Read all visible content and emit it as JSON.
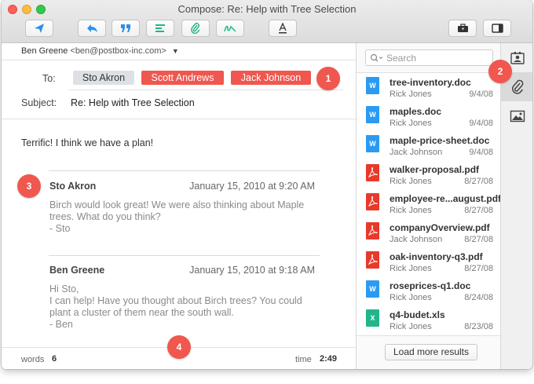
{
  "window": {
    "title": "Compose: Re: Help with Tree Selection"
  },
  "toolbar": {
    "buttons": [
      {
        "name": "send-icon",
        "color": "#2b8fe8"
      },
      {
        "name": "reply-icon",
        "color": "#2b8fe8"
      },
      {
        "name": "quote-icon",
        "color": "#2b8fe8"
      },
      {
        "name": "align-icon",
        "color": "#20b58a"
      },
      {
        "name": "attach-icon",
        "color": "#20b58a"
      },
      {
        "name": "signature-icon",
        "color": "#20b58a"
      },
      {
        "name": "text-format-icon",
        "color": "#333333"
      },
      {
        "name": "toolbox-icon",
        "color": "#333333"
      },
      {
        "name": "panel-toggle-icon",
        "color": "#333333"
      }
    ]
  },
  "from": {
    "name": "Ben Greene",
    "email": "<ben@postbox-inc.com>"
  },
  "to": {
    "label": "To:",
    "recipients": [
      {
        "name": "Sto Akron",
        "style": "grey"
      },
      {
        "name": "Scott Andrews",
        "style": "red"
      },
      {
        "name": "Jack Johnson",
        "style": "red"
      }
    ]
  },
  "subject": {
    "label": "Subject:",
    "value": "Re: Help with Tree Selection"
  },
  "body": {
    "intro": "Terrific! I think we have a plan!",
    "quotes": [
      {
        "author": "Sto Akron",
        "date": "January 15, 2010 at 9:20 AM",
        "lines": [
          "Birch would look great!  We were also thinking about Maple",
          "trees.  What do you think?",
          "- Sto"
        ]
      },
      {
        "author": "Ben Greene",
        "date": "January 15, 2010 at 9:18 AM",
        "lines": [
          "Hi Sto,",
          "I can help!  Have you thought about Birch trees?  You could",
          "plant a cluster of them near the south wall.",
          "- Ben"
        ]
      }
    ]
  },
  "status": {
    "words_label": "words",
    "words_value": "6",
    "time_label": "time",
    "time_value": "2:49"
  },
  "search": {
    "placeholder": "Search"
  },
  "attachments": [
    {
      "name": "tree-inventory.doc",
      "author": "Rick Jones",
      "date": "9/4/08",
      "type": "doc"
    },
    {
      "name": "maples.doc",
      "author": "Rick Jones",
      "date": "9/4/08",
      "type": "doc"
    },
    {
      "name": "maple-price-sheet.doc",
      "author": "Jack Johnson",
      "date": "9/4/08",
      "type": "doc"
    },
    {
      "name": "walker-proposal.pdf",
      "author": "Rick Jones",
      "date": "8/27/08",
      "type": "pdf"
    },
    {
      "name": "employee-re...august.pdf",
      "author": "Rick Jones",
      "date": "8/27/08",
      "type": "pdf"
    },
    {
      "name": "companyOverview.pdf",
      "author": "Jack Johnson",
      "date": "8/27/08",
      "type": "pdf"
    },
    {
      "name": "oak-inventory-q3.pdf",
      "author": "Rick Jones",
      "date": "8/27/08",
      "type": "pdf"
    },
    {
      "name": "roseprices-q1.doc",
      "author": "Rick Jones",
      "date": "8/24/08",
      "type": "doc"
    },
    {
      "name": "q4-budet.xls",
      "author": "Rick Jones",
      "date": "8/23/08",
      "type": "xls"
    }
  ],
  "file_type_glyphs": {
    "doc": "W",
    "pdf": "",
    "xls": "X"
  },
  "load_more": "Load more results",
  "side_tabs": [
    {
      "name": "contacts-icon",
      "active": false
    },
    {
      "name": "attachments-icon",
      "active": true
    },
    {
      "name": "images-icon",
      "active": false
    }
  ],
  "callouts": [
    "1",
    "2",
    "3",
    "4"
  ],
  "colors": {
    "accent_red": "#f0574f",
    "chip_grey": "#dde1e6",
    "doc_blue": "#2b9af3",
    "pdf_red": "#e8392b",
    "xls_green": "#20b58a"
  }
}
